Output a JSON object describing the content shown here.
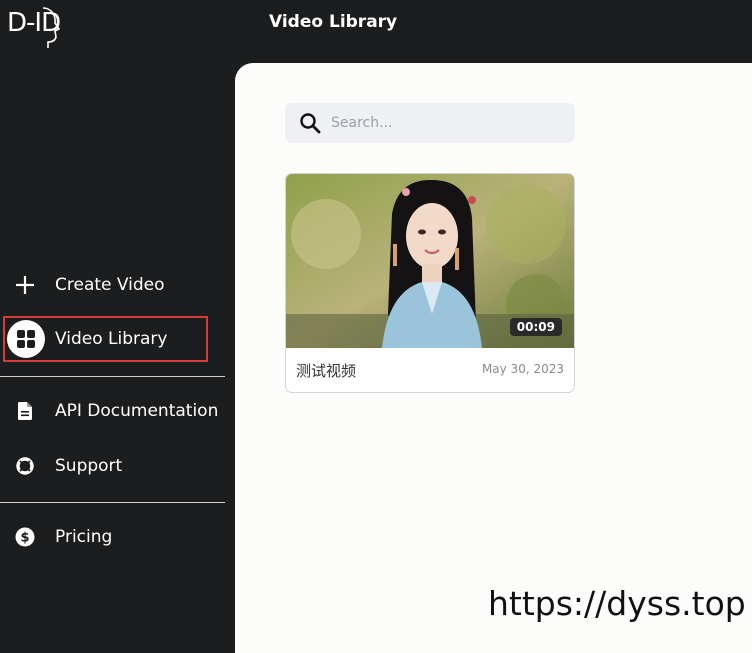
{
  "brand": {
    "logo_text": "D-ID"
  },
  "header": {
    "title": "Video Library"
  },
  "sidebar": {
    "items": [
      {
        "label": "Create Video",
        "icon": "plus-icon"
      },
      {
        "label": "Video Library",
        "icon": "grid-icon",
        "active": true
      },
      {
        "label": "API Documentation",
        "icon": "document-icon"
      },
      {
        "label": "Support",
        "icon": "lifebuoy-icon"
      },
      {
        "label": "Pricing",
        "icon": "dollar-icon"
      }
    ]
  },
  "search": {
    "placeholder": "Search..."
  },
  "videos": [
    {
      "title": "测试视频",
      "date": "May 30, 2023",
      "duration": "00:09"
    }
  ],
  "watermark": "https://dyss.top",
  "colors": {
    "sidebar_bg": "#1c1d1e",
    "main_bg": "#fcfcfb",
    "active_outline": "#d93a3a",
    "search_bg": "#eef0f4"
  }
}
